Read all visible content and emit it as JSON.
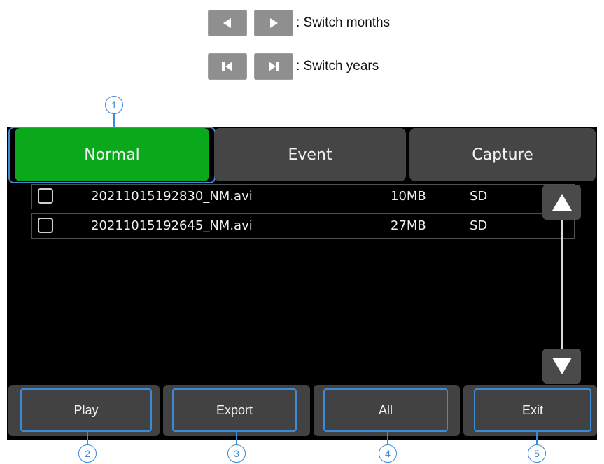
{
  "legend": {
    "months_text": ": Switch months",
    "years_text": ": Switch years",
    "months_icons": [
      "triangle-left-icon",
      "triangle-right-icon"
    ],
    "years_icons": [
      "skip-back-icon",
      "skip-forward-icon"
    ]
  },
  "tabs": [
    {
      "label": "Normal",
      "active": true
    },
    {
      "label": "Event",
      "active": false
    },
    {
      "label": "Capture",
      "active": false
    }
  ],
  "files": [
    {
      "name": "20211015192830_NM.avi",
      "size": "10MB",
      "storage": "SD",
      "checked": false
    },
    {
      "name": "20211015192645_NM.avi",
      "size": "27MB",
      "storage": "SD",
      "checked": false
    }
  ],
  "bottom_buttons": [
    {
      "label": "Play"
    },
    {
      "label": "Export"
    },
    {
      "label": "All"
    },
    {
      "label": "Exit"
    }
  ],
  "callouts": [
    "1",
    "2",
    "3",
    "4",
    "5"
  ],
  "colors": {
    "active_tab": "#0aa81b",
    "tab": "#454545",
    "callout": "#3c8ad8",
    "screen": "#000000"
  }
}
